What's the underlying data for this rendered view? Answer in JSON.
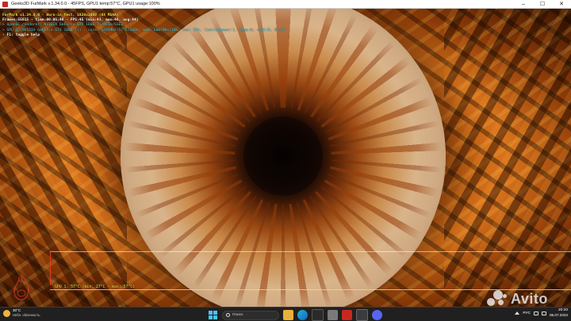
{
  "window": {
    "title": "Geeks3D FurMark v.1.34.0.0 - 45FPS, GPU1 temp:57°C, GPU1 usage:100%",
    "controls": {
      "minimize": "–",
      "maximize": "☐",
      "close": "✕"
    }
  },
  "overlay": {
    "lines": [
      "FurMark v1.34.0.0 - Burn-in test, 1920x1080 (0X MSAA)",
      "Frames:55615 - time:00:05:48 - FPS:45 (min:43, max:46, avg:44)",
      "> OpenGL renderer: NVIDIA GeForce GTX 1660 Ti/PCIe/SSE2",
      "> GPU 1 (NVIDIA GeForce GTX 1660 Ti) - core: 1785MHz/57°C/100%, mem: 6001MHz/10%, fan: 52%, limits(power:1, temp:0, volt:0, OV:0)",
      "- F1: toggle help"
    ]
  },
  "gpu_graph": {
    "label": "GPU 1: 57°C (min: 27°C - max: 57°C)"
  },
  "watermark": {
    "text": "Avito"
  },
  "taskbar": {
    "weather": {
      "temp": "30°C",
      "condition": "Небл. облачность"
    },
    "search_placeholder": "Поиск",
    "lang": "РУС",
    "time": "20:20",
    "date": "06.07.2023"
  },
  "colors": {
    "overlay_yellow": "#f3e24a",
    "overlay_cyan": "#58d8e8",
    "taskbar_bg": "#202020",
    "accent": "#4cc2ff"
  }
}
